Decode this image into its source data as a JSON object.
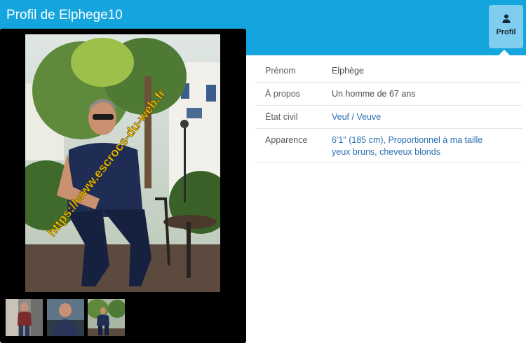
{
  "header": {
    "title": "Profil de Elphege10",
    "tab_profil": {
      "label": "Profil",
      "icon": "user-icon",
      "active": true
    }
  },
  "colors": {
    "header_bg": "#14a4de",
    "tab_bg": "#7fcef0",
    "link": "#2a6fb3",
    "watermark": "#f2c200"
  },
  "photos": {
    "main": {
      "watermark": "https://www.escrocs-du-web.fr"
    },
    "thumbnails": [
      {
        "name": "thumbnail-1"
      },
      {
        "name": "thumbnail-2"
      },
      {
        "name": "thumbnail-3"
      }
    ]
  },
  "details": [
    {
      "label": "Prénom",
      "value": "Elphège",
      "link": false
    },
    {
      "label": "À propos",
      "value": "Un homme de 67 ans",
      "link": false
    },
    {
      "label": "État civil",
      "value": "Veuf / Veuve",
      "link": true
    },
    {
      "label": "Apparence",
      "value": "6'1\" (185 cm), Proportionnel à ma taille yeux bruns, cheveux blonds",
      "link": true
    }
  ]
}
